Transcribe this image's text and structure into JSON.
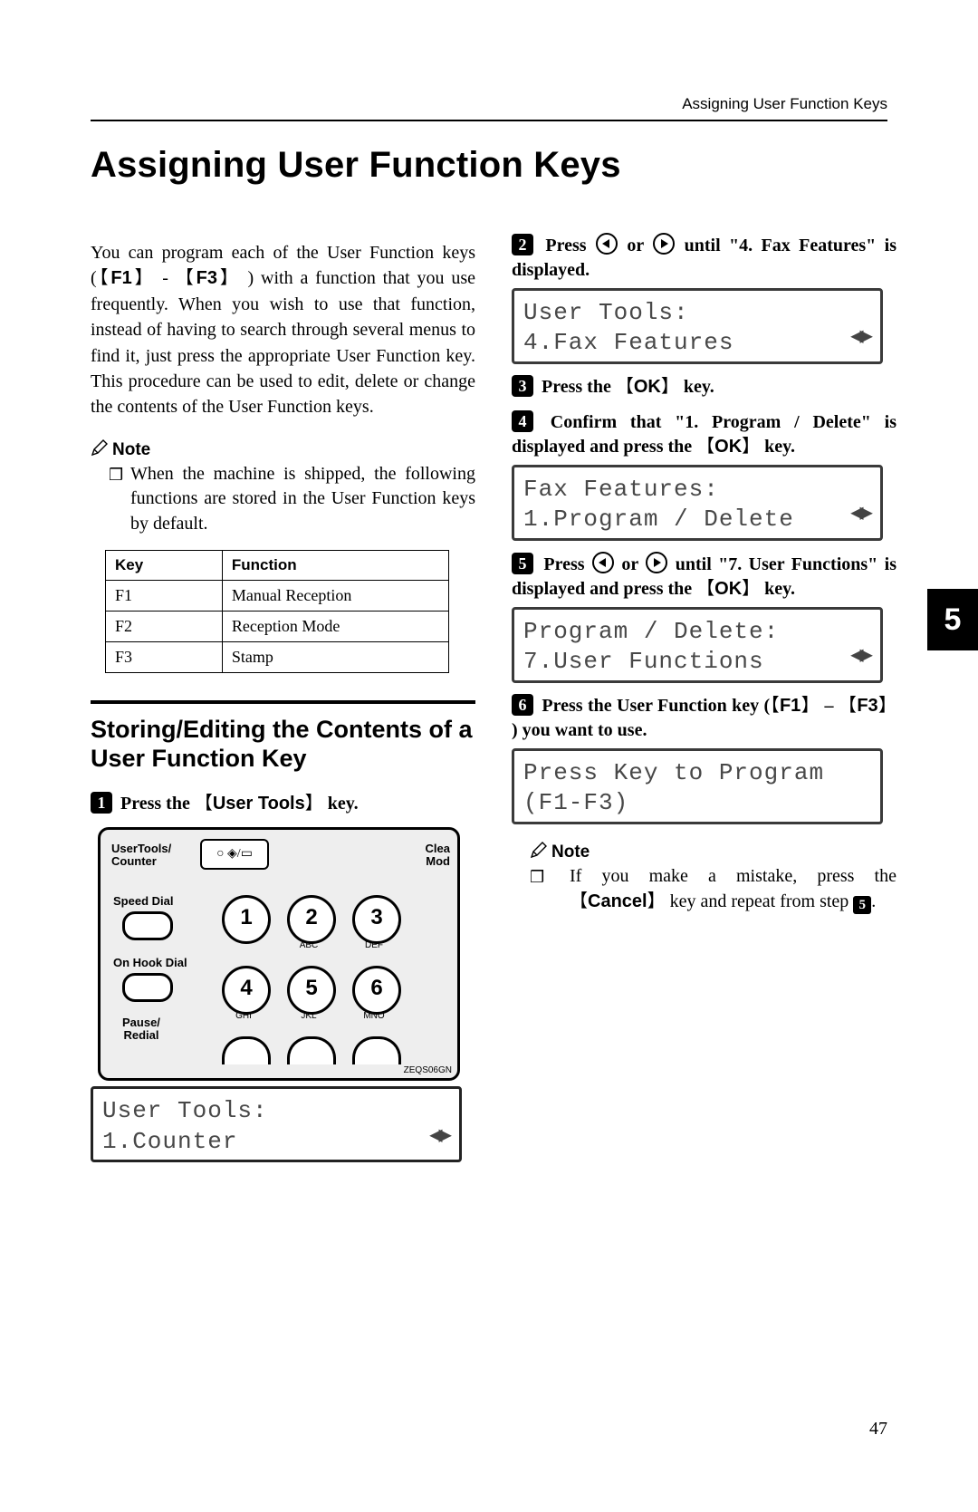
{
  "running_head": "Assigning User Function Keys",
  "title": "Assigning User Function Keys",
  "side_tab": "5",
  "page_num": "47",
  "left": {
    "intro_a": "You can program each of the User Function keys (",
    "f1": "F1",
    "intro_b": " - ",
    "f3": "F3",
    "intro_c": " ) with a function that you use frequently. When you wish to use that function, instead of having to search through several menus to find it, just press the appropriate User Function key. This procedure can be used to edit, delete or change the contents of the User Function keys.",
    "note_label": "Note",
    "note_text": "When the machine is shipped, the following functions are stored in the User Function keys by default.",
    "table": {
      "head_key": "Key",
      "head_func": "Function",
      "rows": [
        {
          "k": "F1",
          "f": "Manual Reception"
        },
        {
          "k": "F2",
          "f": "Reception Mode"
        },
        {
          "k": "F3",
          "f": "Stamp"
        }
      ]
    },
    "section": "Storing/Editing the Contents of a User Function Key",
    "step1_a": "Press the ",
    "step1_key": "User Tools",
    "step1_b": " key.",
    "panel": {
      "usertools": "UserTools/\nCounter",
      "clear": "Clea\nMod",
      "speed": "Speed Dial",
      "onhook": "On Hook Dial",
      "pause": "Pause/\nRedial",
      "code": "ZEQS06GN",
      "keys": [
        {
          "n": "1",
          "s": ""
        },
        {
          "n": "2",
          "s": "ABC"
        },
        {
          "n": "3",
          "s": "DEF"
        },
        {
          "n": "4",
          "s": "GHI"
        },
        {
          "n": "5",
          "s": "JKL"
        },
        {
          "n": "6",
          "s": "MNO"
        }
      ]
    },
    "lcd1_a": "User Tools:",
    "lcd1_b": "1.Counter"
  },
  "right": {
    "step2_a": "Press ",
    "step2_b": " or ",
    "step2_c": " until \"4. Fax Features\" is displayed.",
    "lcd2_a": "User Tools:",
    "lcd2_b": "4.Fax Features",
    "step3_a": "Press the ",
    "step3_key": "OK",
    "step3_b": " key.",
    "step4_a": "Confirm that \"1. Program / Delete\" is displayed and press the ",
    "step4_key": "OK",
    "step4_b": " key.",
    "lcd3_a": "Fax Features:",
    "lcd3_b": "1.Program / Delete",
    "step5_a": "Press ",
    "step5_b": " or ",
    "step5_c": " until \"7. User Functions\" is displayed and press the ",
    "step5_key": "OK",
    "step5_d": " key.",
    "lcd4_a": "Program / Delete:",
    "lcd4_b": "7.User Functions",
    "step6_a": "Press the User Function key (",
    "step6_f1": "F1",
    "step6_b": " – ",
    "step6_f3": "F3",
    "step6_c": " ) you want to use.",
    "lcd5_a": "Press Key to Program",
    "lcd5_b": "(F1-F3)",
    "note_label": "Note",
    "note_a": "If you make a mistake, press the ",
    "note_key": "Cancel",
    "note_b": " key and repeat from step ",
    "note_step": "5",
    "note_c": "."
  }
}
